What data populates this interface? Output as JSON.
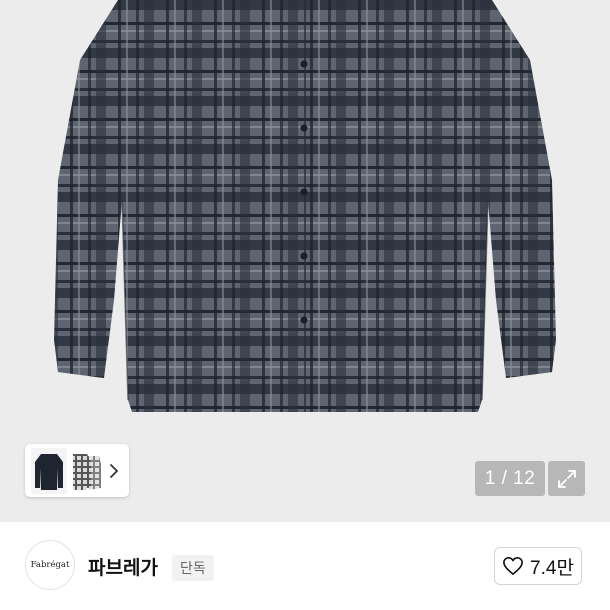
{
  "viewer": {
    "counter": "1 / 12",
    "expand_icon": "expand-arrows-icon",
    "thumb_next_icon": "chevron-right-icon"
  },
  "thumbnails": [
    {
      "name": "navy-shirt-thumb",
      "color": "#1e2530"
    },
    {
      "name": "check-shirt-thumb",
      "color": "#cfcfcf"
    },
    {
      "name": "check-shirt-thumb-2",
      "color": "#9a9a9a"
    }
  ],
  "brand": {
    "logo_text": "Fabrégat",
    "name": "파브레가",
    "tag": "단독",
    "likes": "7.4만",
    "like_icon": "heart-outline-icon"
  },
  "colors": {
    "viewer_bg": "#ececec",
    "shirt_base": "#5e6470",
    "shirt_dark": "#1f2430",
    "shirt_light": "#8a8f99"
  }
}
